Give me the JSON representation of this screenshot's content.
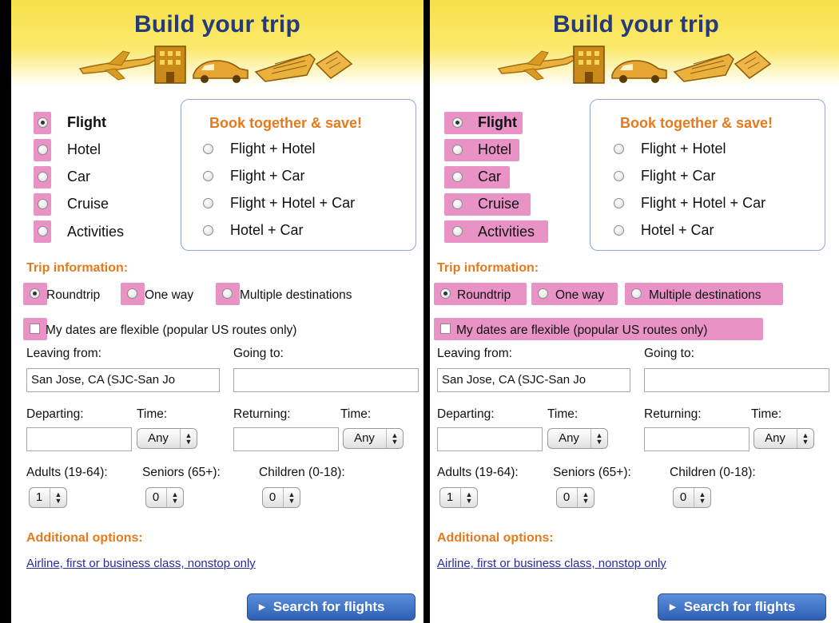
{
  "title": "Build your trip",
  "trip_types": [
    {
      "label": "Flight",
      "selected": true
    },
    {
      "label": "Hotel",
      "selected": false
    },
    {
      "label": "Car",
      "selected": false
    },
    {
      "label": "Cruise",
      "selected": false
    },
    {
      "label": "Activities",
      "selected": false
    }
  ],
  "bundles": {
    "title": "Book together & save!",
    "options": [
      "Flight + Hotel",
      "Flight + Car",
      "Flight + Hotel + Car",
      "Hotel + Car"
    ]
  },
  "trip_info": {
    "heading": "Trip information:",
    "roundtrip": "Roundtrip",
    "one_way": "One way",
    "multiple": "Multiple destinations",
    "flexible": "My dates are flexible (popular US routes only)"
  },
  "form": {
    "leaving_label": "Leaving from:",
    "leaving_value": "San Jose, CA (SJC-San Jo",
    "going_label": "Going to:",
    "going_value": "",
    "departing_label": "Departing:",
    "returning_label": "Returning:",
    "time_label": "Time:",
    "time_value": "Any",
    "adults_label": "Adults (19-64):",
    "adults_value": "1",
    "seniors_label": "Seniors (65+):",
    "seniors_value": "0",
    "children_label": "Children (0-18):",
    "children_value": "0"
  },
  "additional": {
    "heading": "Additional options:",
    "link": "Airline, first or business class, nonstop only"
  },
  "search_button": "Search for flights",
  "colors": {
    "header_yellow": "#f7e04a",
    "title_blue": "#243a7a",
    "accent_orange": "#e57a1c",
    "highlight_pink": "#e892c6",
    "button_blue": "#2f5fb5",
    "link_blue": "#2a2a9a"
  },
  "icons": [
    "airplane-icon",
    "hotel-icon",
    "car-icon",
    "cruise-ship-icon",
    "activities-ticket-icon"
  ]
}
